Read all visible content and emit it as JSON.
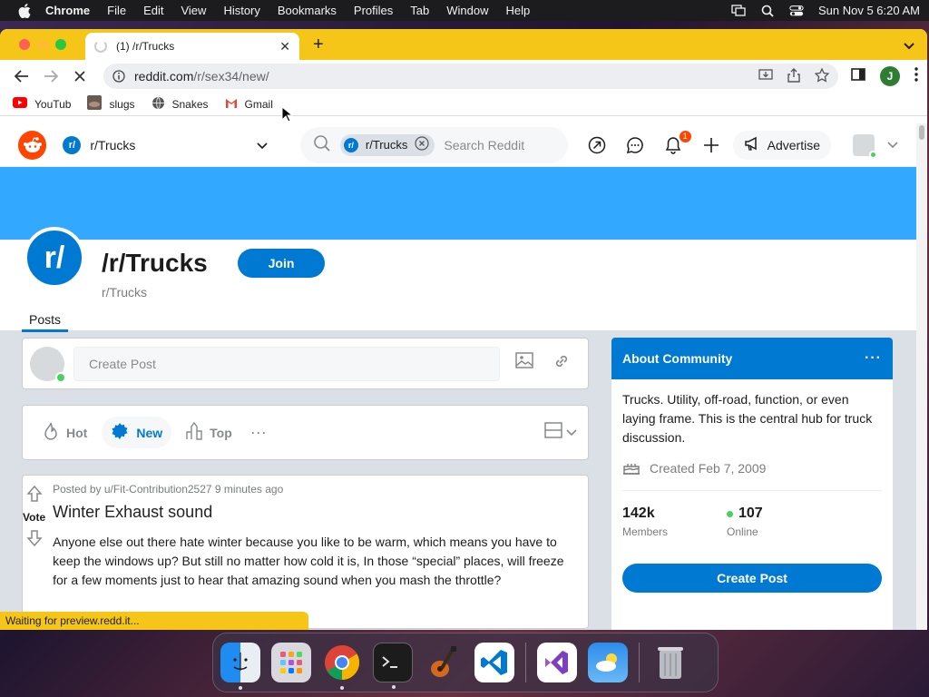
{
  "menubar": {
    "app": "Chrome",
    "items": [
      "File",
      "Edit",
      "View",
      "History",
      "Bookmarks",
      "Profiles",
      "Tab",
      "Window",
      "Help"
    ],
    "clock": "Sun Nov 5  6:20 AM"
  },
  "browser": {
    "tab_title": "(1) /r/Trucks",
    "url_host": "reddit.com",
    "url_path": "/r/sex34/new/",
    "profile_initial": "J",
    "bookmarks": [
      {
        "label": "YouTub",
        "icon": "youtube-icon"
      },
      {
        "label": "slugs",
        "icon": "slug-icon"
      },
      {
        "label": "Snakes",
        "icon": "globe-icon"
      },
      {
        "label": "Gmail",
        "icon": "gmail-icon"
      }
    ],
    "status": "Waiting for preview.redd.it..."
  },
  "reddit": {
    "header": {
      "subreddit": "r/Trucks",
      "search_chip": "r/Trucks",
      "search_placeholder": "Search Reddit",
      "notification_count": "1",
      "advertise": "Advertise"
    },
    "sub": {
      "title": "/r/Trucks",
      "name": "r/Trucks",
      "icon_text": "r/",
      "join": "Join",
      "tab": "Posts"
    },
    "create_post_placeholder": "Create Post",
    "sort": {
      "hot": "Hot",
      "new": "New",
      "top": "Top",
      "more": "···"
    },
    "post": {
      "meta": "Posted by u/Fit-Contribution2527 9 minutes ago",
      "vote": "Vote",
      "title": "Winter Exhaust sound",
      "text": "Anyone else out there hate winter because you like to be warm, which means you have to keep the windows up? But still no matter how cold it is, In those “special” places, will freeze for a few moments just to hear that amazing sound when you mash the throttle?"
    },
    "about": {
      "heading": "About Community",
      "description": "Trucks. Utility, off-road, function, or even laying frame. This is the central hub for truck discussion.",
      "created": "Created Feb 7, 2009",
      "members_value": "142k",
      "members_label": "Members",
      "online_value": "107",
      "online_label": "Online",
      "create_post": "Create Post"
    }
  },
  "colors": {
    "reddit_orange": "#ff4500",
    "reddit_blue": "#0079d3",
    "banner": "#33a8ff",
    "chrome_frame": "#f5c518"
  }
}
